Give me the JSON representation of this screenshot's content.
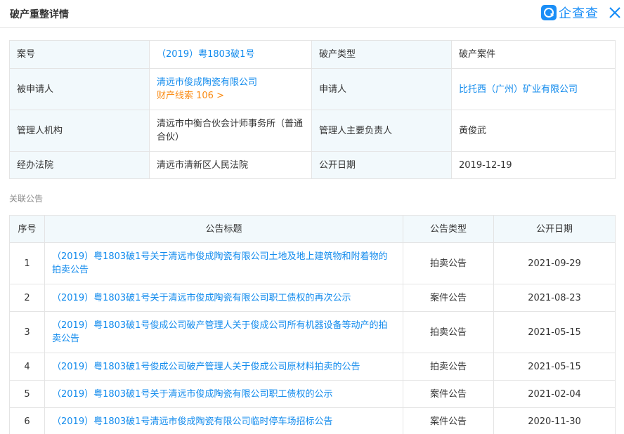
{
  "header": {
    "title": "破产重整详情",
    "logo_text": "企查查"
  },
  "details": [
    {
      "label1": "案号",
      "value1": "（2019）粤1803破1号",
      "label2": "破产类型",
      "value2": "破产案件"
    },
    {
      "label1": "被申请人",
      "value1": "清远市俊成陶瓷有限公司",
      "value1_extra": "财产线索 106 >",
      "label2": "申请人",
      "value2": "比托西（广州）矿业有限公司"
    },
    {
      "label1": "管理人机构",
      "value1": "清远市中衡合伙会计师事务所（普通合伙）",
      "label2": "管理人主要负责人",
      "value2": "黄俊武"
    },
    {
      "label1": "经办法院",
      "value1": "清远市清新区人民法院",
      "label2": "公开日期",
      "value2": "2019-12-19"
    }
  ],
  "related": {
    "section_label": "关联公告",
    "columns": [
      "序号",
      "公告标题",
      "公告类型",
      "公开日期"
    ],
    "rows": [
      {
        "no": "1",
        "title": "（2019）粤1803破1号关于清远市俊成陶瓷有限公司土地及地上建筑物和附着物的拍卖公告",
        "type": "拍卖公告",
        "date": "2021-09-29"
      },
      {
        "no": "2",
        "title": "（2019）粤1803破1号关于清远市俊成陶瓷有限公司职工债权的再次公示",
        "type": "案件公告",
        "date": "2021-08-23"
      },
      {
        "no": "3",
        "title": "（2019）粤1803破1号俊成公司破产管理人关于俊成公司所有机器设备等动产的拍卖公告",
        "type": "拍卖公告",
        "date": "2021-05-15"
      },
      {
        "no": "4",
        "title": "（2019）粤1803破1号俊成公司破产管理人关于俊成公司原材料拍卖的公告",
        "type": "拍卖公告",
        "date": "2021-05-15"
      },
      {
        "no": "5",
        "title": "（2019）粤1803破1号关于清远市俊成陶瓷有限公司职工债权的公示",
        "type": "案件公告",
        "date": "2021-02-04"
      },
      {
        "no": "6",
        "title": "（2019）粤1803破1号清远市俊成陶瓷有限公司临时停车场招标公告",
        "type": "案件公告",
        "date": "2020-11-30"
      }
    ]
  },
  "colors": {
    "link": "#128bed",
    "orange": "#fa8c16",
    "label_bg": "#f2f9fc",
    "border": "#e4e4e4"
  },
  "icons": {
    "logo": "qichacha-logo-icon",
    "close": "close-icon"
  }
}
